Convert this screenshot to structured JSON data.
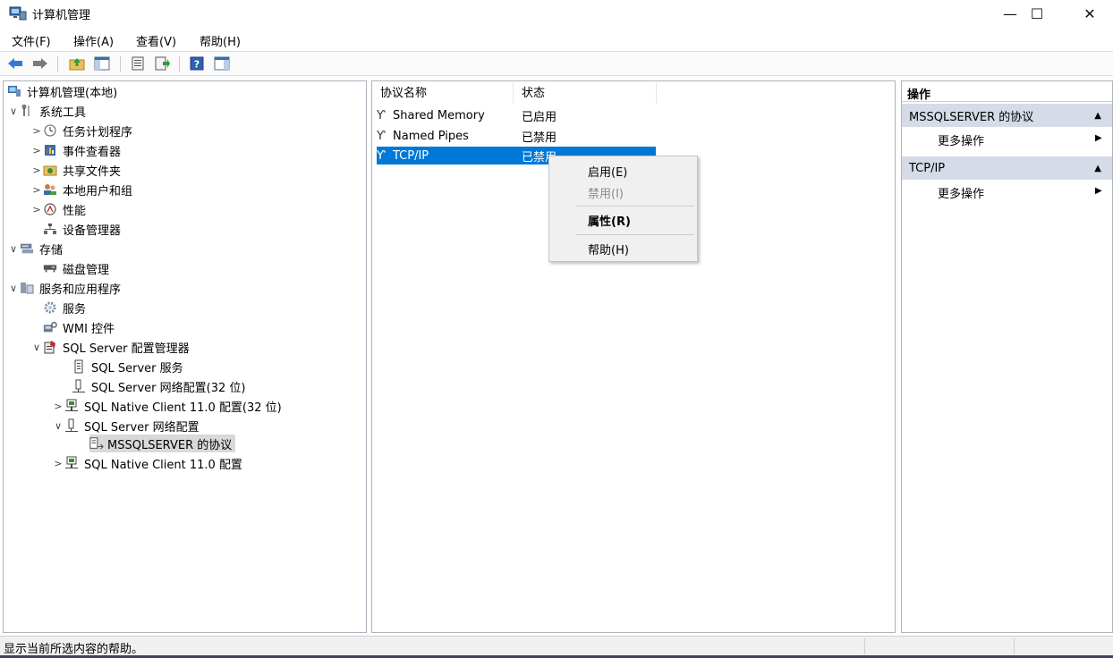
{
  "window": {
    "title": "计算机管理",
    "minimize_glyph": "—",
    "maximize_glyph": "☐",
    "close_glyph": "✕"
  },
  "menu": [
    "文件(F)",
    "操作(A)",
    "查看(V)",
    "帮助(H)"
  ],
  "toolbar": {
    "icons": [
      "back-arrow-icon",
      "forward-arrow-icon",
      "up-folder-icon",
      "show-hide-tree-icon",
      "properties-icon",
      "export-list-icon",
      "help-icon",
      "show-hide-action-pane-icon"
    ]
  },
  "tree": [
    {
      "label": "计算机管理(本地)",
      "icon": "computer-management-icon",
      "chevron": ""
    },
    {
      "label": "系统工具",
      "icon": "system-tools-icon",
      "chevron": "∨"
    },
    {
      "label": "任务计划程序",
      "icon": "clock-icon",
      "chevron": ">"
    },
    {
      "label": "事件查看器",
      "icon": "event-viewer-icon",
      "chevron": ">"
    },
    {
      "label": "共享文件夹",
      "icon": "shared-folder-icon",
      "chevron": ">"
    },
    {
      "label": "本地用户和组",
      "icon": "users-icon",
      "chevron": ">"
    },
    {
      "label": "性能",
      "icon": "performance-icon",
      "chevron": ">"
    },
    {
      "label": "设备管理器",
      "icon": "device-manager-icon",
      "chevron": ""
    },
    {
      "label": "存储",
      "icon": "storage-icon",
      "chevron": "∨"
    },
    {
      "label": "磁盘管理",
      "icon": "disk-icon",
      "chevron": ""
    },
    {
      "label": "服务和应用程序",
      "icon": "services-apps-icon",
      "chevron": "∨"
    },
    {
      "label": "服务",
      "icon": "services-gear-icon",
      "chevron": ""
    },
    {
      "label": "WMI 控件",
      "icon": "wmi-icon",
      "chevron": ""
    },
    {
      "label": "SQL Server 配置管理器",
      "icon": "sql-config-icon",
      "chevron": "∨"
    },
    {
      "label": "SQL Server 服务",
      "icon": "sql-service-icon",
      "chevron": ""
    },
    {
      "label": "SQL Server 网络配置(32 位)",
      "icon": "network-config-icon",
      "chevron": ""
    },
    {
      "label": "SQL Native Client 11.0 配置(32 位)",
      "icon": "native-client-icon",
      "chevron": ">"
    },
    {
      "label": "SQL Server 网络配置",
      "icon": "network-config-icon",
      "chevron": "∨"
    },
    {
      "label": "MSSQLSERVER 的协议",
      "icon": "protocols-icon",
      "chevron": ""
    },
    {
      "label": "SQL Native Client 11.0 配置",
      "icon": "native-client-icon",
      "chevron": ">"
    }
  ],
  "list": {
    "col_name": "协议名称",
    "col_status": "状态",
    "rows": [
      {
        "name": "Shared Memory",
        "status": "已启用"
      },
      {
        "name": "Named Pipes",
        "status": "已禁用"
      },
      {
        "name": "TCP/IP",
        "status": "已禁用"
      }
    ]
  },
  "context_menu": {
    "enable": "启用(E)",
    "disable": "禁用(I)",
    "properties": "属性(R)",
    "help": "帮助(H)"
  },
  "actions": {
    "header": "操作",
    "group1": "MSSQLSERVER 的协议",
    "group1_more": "更多操作",
    "group2": "TCP/IP",
    "group2_more": "更多操作",
    "collapse_glyph": "▲",
    "more_glyph": "▶"
  },
  "status": {
    "text": "显示当前所选内容的帮助。"
  }
}
